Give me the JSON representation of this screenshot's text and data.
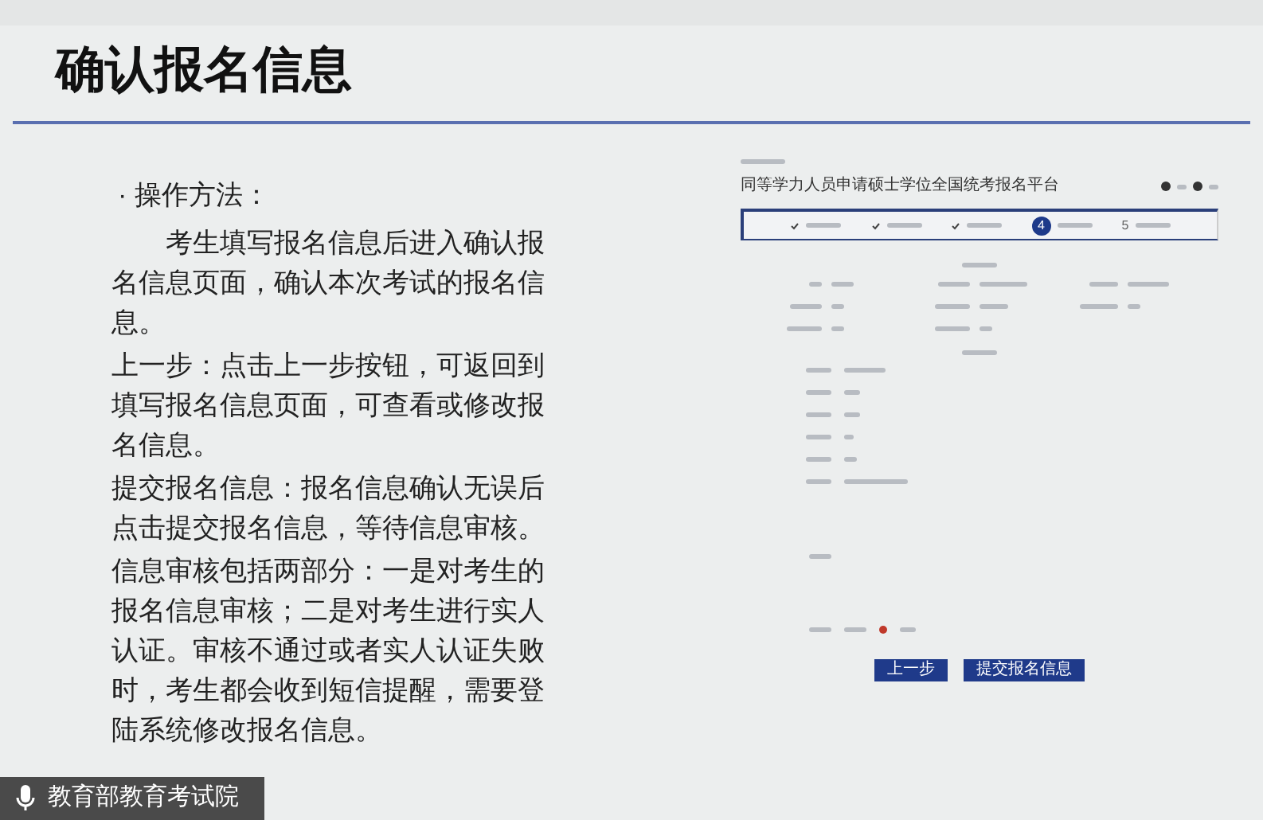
{
  "slide": {
    "title": "确认报名信息",
    "heading": "· 操作方法：",
    "paragraphs": [
      {
        "text": "考生填写报名信息后进入确认报名信息页面，确认本次考试的报名信息。",
        "indent": true
      },
      {
        "text": "上一步：点击上一步按钮，可返回到填写报名信息页面，可查看或修改报名信息。",
        "indent": false
      },
      {
        "text": "提交报名信息：报名信息确认无误后点击提交报名信息，等待信息审核。",
        "indent": false
      },
      {
        "text": "信息审核包括两部分：一是对考生的报名信息审核；二是对考生进行实人认证。审核不通过或者实人认证失败时，考生都会收到短信提醒，需要登陆系统修改报名信息。",
        "indent": false
      }
    ]
  },
  "screenshot": {
    "title": "同等学力人员申请硕士学位全国统考报名平台",
    "steps": [
      {
        "kind": "done"
      },
      {
        "kind": "done"
      },
      {
        "kind": "done"
      },
      {
        "kind": "current",
        "number": "4"
      },
      {
        "kind": "todo",
        "number": "5"
      }
    ],
    "buttons": [
      "上一步",
      "提交报名信息"
    ]
  },
  "caption": {
    "text": "教育部教育考试院"
  }
}
